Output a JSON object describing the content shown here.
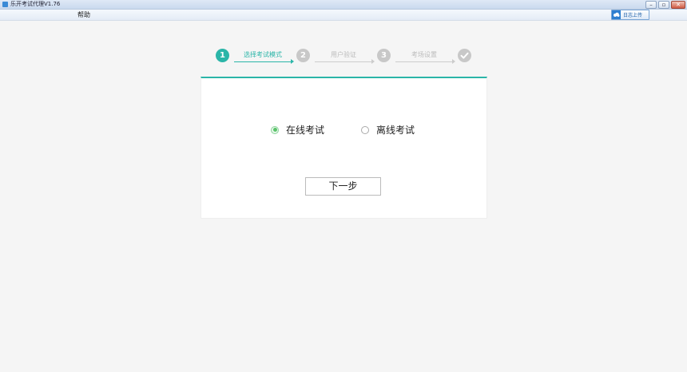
{
  "window": {
    "title": "乐开考试代理V1.76"
  },
  "menu": {
    "help": "帮助"
  },
  "upload": {
    "label": "日志上传"
  },
  "stepper": {
    "steps": [
      {
        "num": "1",
        "label": "选择考试模式"
      },
      {
        "num": "2",
        "label": "用户验证"
      },
      {
        "num": "3",
        "label": "考场设置"
      }
    ],
    "done_icon": "check-icon"
  },
  "mode": {
    "online_label": "在线考试",
    "offline_label": "离线考试",
    "selected": "online"
  },
  "actions": {
    "next_label": "下一步"
  },
  "colors": {
    "accent": "#2bb5a8",
    "radio_selected": "#5bc36b"
  }
}
